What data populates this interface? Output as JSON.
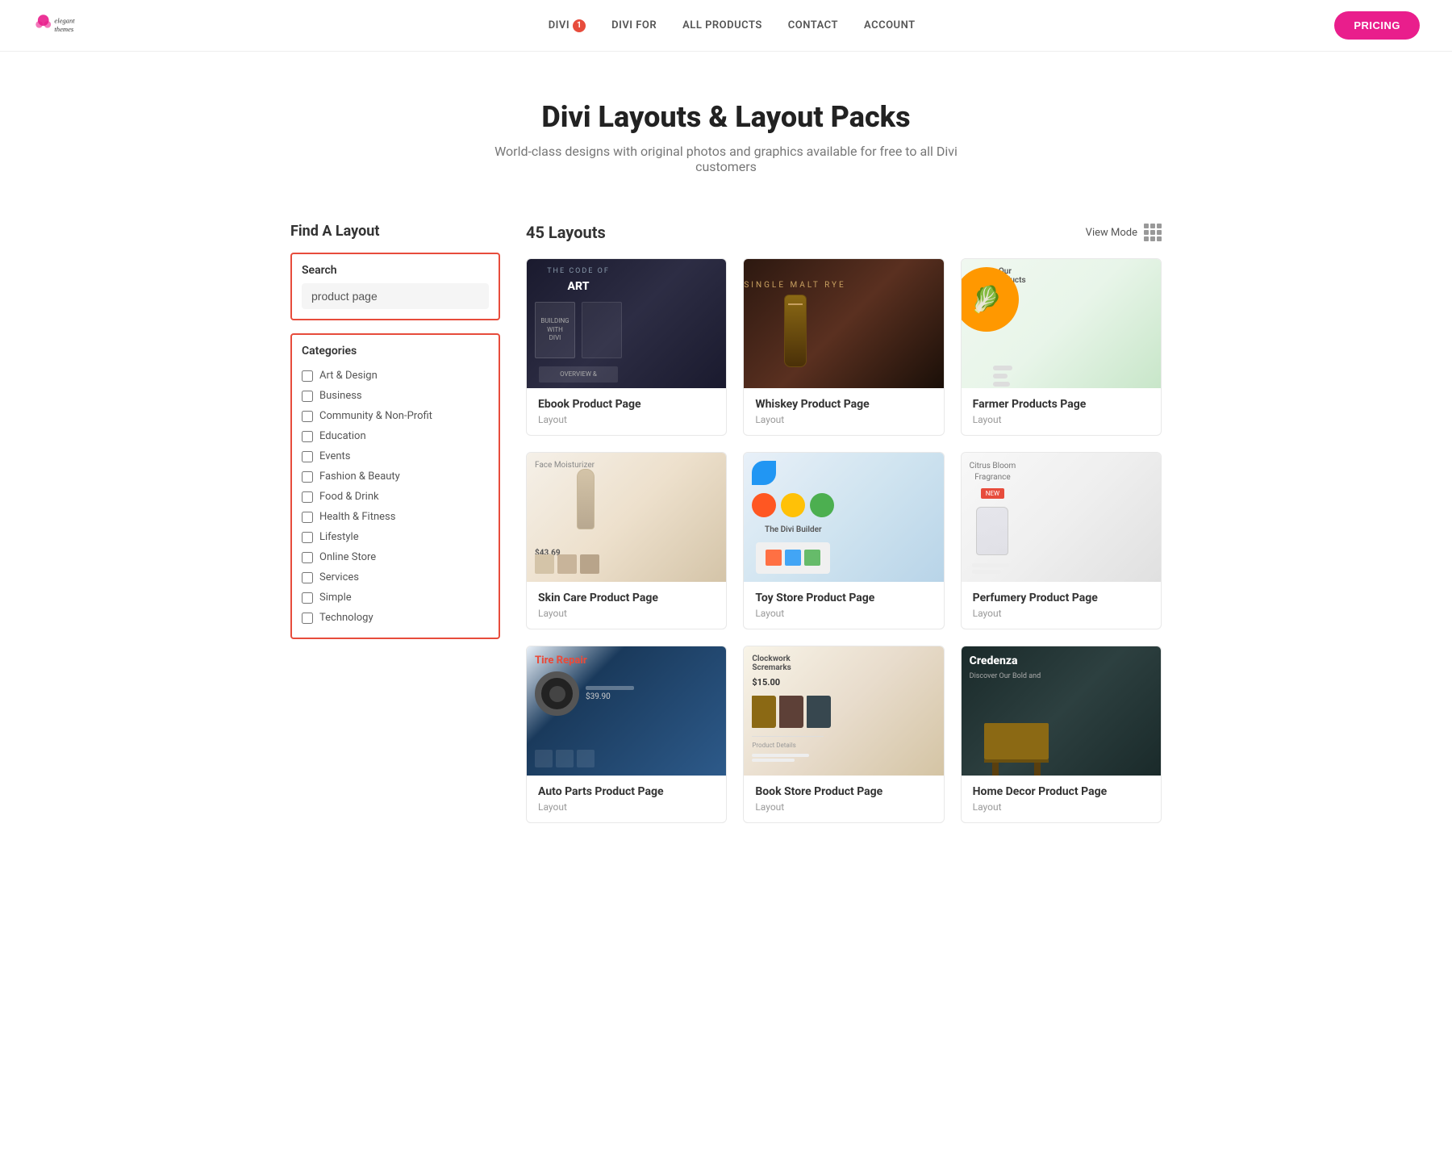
{
  "nav": {
    "logo_text": "elegant themes",
    "links": [
      {
        "label": "DIVI",
        "badge": "1",
        "id": "divi"
      },
      {
        "label": "DIVI FOR",
        "id": "divi-for"
      },
      {
        "label": "ALL PRODUCTS",
        "id": "all-products"
      },
      {
        "label": "CONTACT",
        "id": "contact"
      },
      {
        "label": "ACCOUNT",
        "id": "account"
      }
    ],
    "pricing_label": "PRICING"
  },
  "hero": {
    "title": "Divi Layouts & Layout Packs",
    "subtitle": "World-class designs with original photos and graphics available for free to all Divi customers"
  },
  "sidebar": {
    "title": "Find A Layout",
    "search": {
      "label": "Search",
      "placeholder": "product page",
      "value": "product page"
    },
    "categories": {
      "title": "Categories",
      "items": [
        {
          "label": "Art & Design",
          "checked": false
        },
        {
          "label": "Business",
          "checked": false
        },
        {
          "label": "Community & Non-Profit",
          "checked": false
        },
        {
          "label": "Education",
          "checked": false
        },
        {
          "label": "Events",
          "checked": false
        },
        {
          "label": "Fashion & Beauty",
          "checked": false
        },
        {
          "label": "Food & Drink",
          "checked": false
        },
        {
          "label": "Health & Fitness",
          "checked": false
        },
        {
          "label": "Lifestyle",
          "checked": false
        },
        {
          "label": "Online Store",
          "checked": false
        },
        {
          "label": "Services",
          "checked": false
        },
        {
          "label": "Simple",
          "checked": false
        },
        {
          "label": "Technology",
          "checked": false
        }
      ]
    }
  },
  "content": {
    "layouts_count": "45 Layouts",
    "view_mode_label": "View Mode",
    "cards": [
      {
        "id": "ebook",
        "name": "Ebook Product Page",
        "type": "Layout",
        "thumb_class": "thumb-ebook",
        "thumb_text": "THE CODE OF ART / BUILDING WITH DIVI"
      },
      {
        "id": "whiskey",
        "name": "Whiskey Product Page",
        "type": "Layout",
        "thumb_class": "thumb-whiskey",
        "thumb_text": "SINGLE MALT RYE"
      },
      {
        "id": "farmer",
        "name": "Farmer Products Page",
        "type": "Layout",
        "thumb_class": "thumb-farmer",
        "thumb_text": "Our Products"
      },
      {
        "id": "skincare",
        "name": "Skin Care Product Page",
        "type": "Layout",
        "thumb_class": "thumb-skincare",
        "thumb_text": "Face Moisturizer $43.69"
      },
      {
        "id": "toystore",
        "name": "Toy Store Product Page",
        "type": "Layout",
        "thumb_class": "thumb-toystore",
        "thumb_text": "The Divi Builder"
      },
      {
        "id": "perfumery",
        "name": "Perfumery Product Page",
        "type": "Layout",
        "thumb_class": "thumb-perfumery",
        "thumb_text": "Citrus Bloom Fragrance"
      },
      {
        "id": "autoparts",
        "name": "Auto Parts Product Page",
        "type": "Layout",
        "thumb_class": "thumb-autoparts",
        "thumb_text": "Tire Repair"
      },
      {
        "id": "bookstore",
        "name": "Book Store Product Page",
        "type": "Layout",
        "thumb_class": "thumb-bookstore",
        "thumb_text": "Clockwork Scremarks $15.00"
      },
      {
        "id": "homedecor",
        "name": "Home Decor Product Page",
        "type": "Layout",
        "thumb_class": "thumb-homedecor",
        "thumb_text": "Credenza"
      }
    ]
  },
  "colors": {
    "accent": "#e91e8c",
    "danger": "#e74c3c",
    "layout_type": "#999999"
  }
}
